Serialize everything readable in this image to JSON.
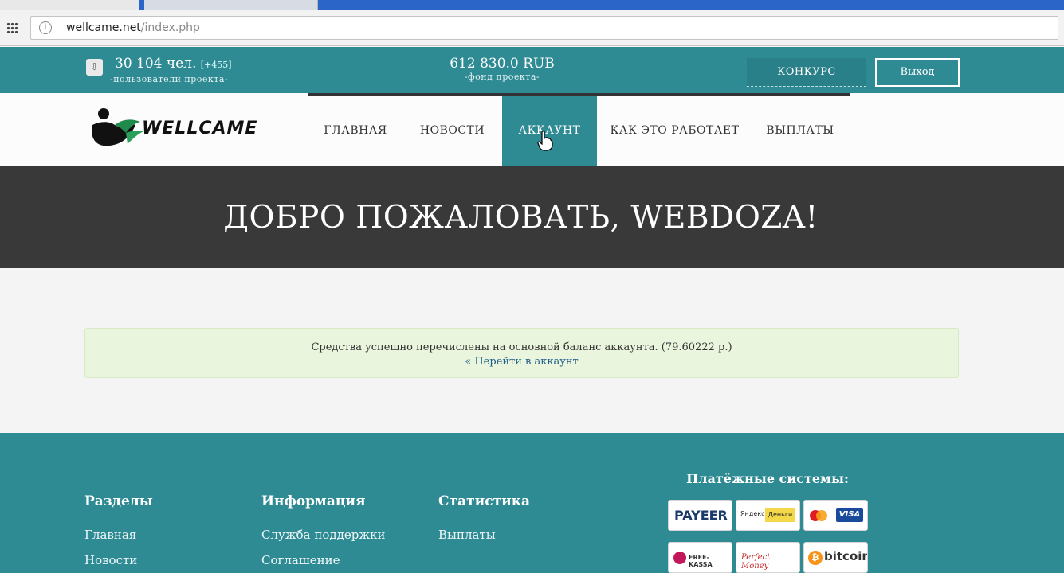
{
  "browser": {
    "url_host": "wellcame.net",
    "url_path": "/index.php"
  },
  "topbar": {
    "users_count": "30 104 чел.",
    "users_delta": "[+455]",
    "users_caption": "-пользователи проекта-",
    "fund_amount": "612 830.0 RUB",
    "fund_caption": "-фонд проекта-",
    "contest_label": "КОНКУРС",
    "logout_label": "Выход"
  },
  "logo": {
    "text": "WELLCAME"
  },
  "nav": {
    "items": [
      {
        "label": "ГЛАВНАЯ"
      },
      {
        "label": "НОВОСТИ"
      },
      {
        "label": "АККАУНТ"
      },
      {
        "label": "КАК ЭТО РАБОТАЕТ"
      },
      {
        "label": "ВЫПЛАТЫ"
      }
    ],
    "active": "АККАУНТ"
  },
  "hero": {
    "title": "ДОБРО ПОЖАЛОВАТЬ, WEBDOZA!"
  },
  "alert": {
    "message": "Средства успешно перечислены на основной баланс аккаунта. (79.60222 р.)",
    "link": "« Перейти в аккаунт"
  },
  "footer": {
    "sections": {
      "title": "Разделы",
      "links": [
        "Главная",
        "Новости"
      ]
    },
    "info": {
      "title": "Информация",
      "links": [
        "Служба поддержки",
        "Соглашение"
      ]
    },
    "stats": {
      "title": "Статистика",
      "links": [
        "Выплаты"
      ]
    },
    "payments": {
      "title": "Платёжные системы:",
      "logos": [
        "PAYEER",
        "Яндекс Деньги",
        "MasterCard VISA",
        "FREE-KASSA",
        "Perfect Money",
        "bitcoin"
      ],
      "payeer": "PAYEER",
      "yandex": "Яндекс",
      "yandex_money": "Деньги",
      "visa": "VISA",
      "freekassa": "FREE-KASSA",
      "perfect": "Perfect Money",
      "bitcoin": "bitcoin"
    }
  },
  "colors": {
    "teal": "#2e8a93",
    "hero_bg": "#393939",
    "alert_bg": "#e9f5dc"
  }
}
